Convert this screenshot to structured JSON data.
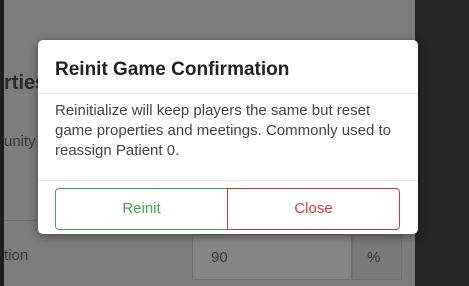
{
  "background": {
    "heading_fragment": "rties",
    "row1_label_fragment": "unity",
    "row2_label_fragment": "tion",
    "row2_value": "90",
    "row2_unit": "%"
  },
  "modal": {
    "title": "Reinit Game Confirmation",
    "body": "Reinitialize will keep players the same but reset game properties and meetings. Commonly used to reassign Patient 0.",
    "buttons": {
      "confirm_label": "Reinit",
      "close_label": "Close"
    }
  },
  "colors": {
    "confirm": "#3fa64a",
    "close": "#d93a36",
    "overlay": "#7d7d7d"
  }
}
